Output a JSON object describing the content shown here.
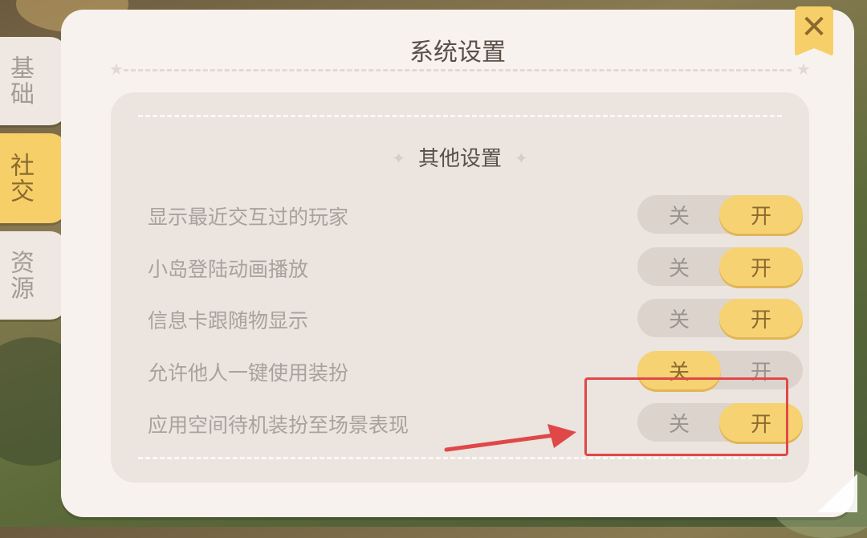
{
  "window": {
    "title": "系统设置"
  },
  "side_tabs": [
    {
      "label": "基础",
      "active": false
    },
    {
      "label": "社交",
      "active": true
    },
    {
      "label": "资源",
      "active": false
    }
  ],
  "close_icon": "close-icon",
  "section": {
    "title": "其他设置"
  },
  "settings": [
    {
      "label": "显示最近交互过的玩家",
      "off_label": "关",
      "on_label": "开",
      "value": "开"
    },
    {
      "label": "小岛登陆动画播放",
      "off_label": "关",
      "on_label": "开",
      "value": "开"
    },
    {
      "label": "信息卡跟随物显示",
      "off_label": "关",
      "on_label": "开",
      "value": "开"
    },
    {
      "label": "允许他人一键使用装扮",
      "off_label": "关",
      "on_label": "开",
      "value": "关"
    },
    {
      "label": "应用空间待机装扮至场景表现",
      "off_label": "关",
      "on_label": "开",
      "value": "开"
    }
  ],
  "colors": {
    "accent": "#f6d272",
    "panel_bg": "#f7f2ee",
    "inner_bg": "#ebe4df",
    "annotation": "#e04848"
  }
}
